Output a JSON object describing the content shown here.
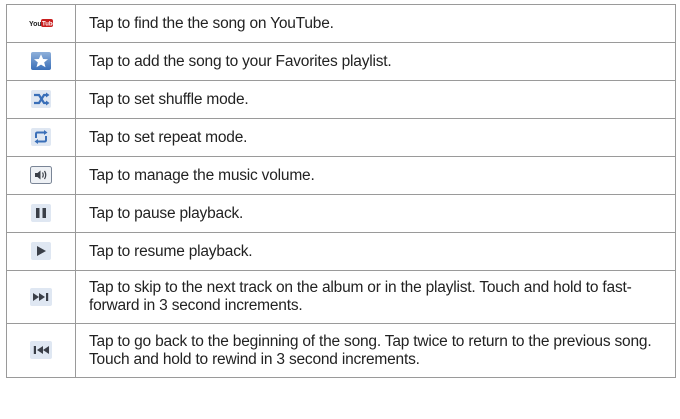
{
  "rows": [
    {
      "icon": "youtube-icon",
      "label": "Tap to find the the song on YouTube."
    },
    {
      "icon": "star-icon",
      "label": "Tap to add the song to your Favorites playlist."
    },
    {
      "icon": "shuffle-icon",
      "label": "Tap to set shuffle mode."
    },
    {
      "icon": "repeat-icon",
      "label": "Tap to set repeat mode."
    },
    {
      "icon": "volume-icon",
      "label": "Tap to manage the music volume."
    },
    {
      "icon": "pause-icon",
      "label": "Tap to pause playback."
    },
    {
      "icon": "play-icon",
      "label": "Tap to resume playback."
    },
    {
      "icon": "next-track-icon",
      "label": "Tap to skip to the next track on the album or in the playlist. Touch and hold to fast-forward in 3 second increments."
    },
    {
      "icon": "previous-track-icon",
      "label": "Tap to go back to the beginning of the song. Tap twice to return to the previous song. Touch and hold to rewind in 3 second increments."
    }
  ],
  "icon_text": {
    "youtube": "You Tube"
  },
  "colors": {
    "icon_blue": "#3a6fb8",
    "icon_light": "#dfe7f2",
    "icon_dark": "#3a3f48",
    "border": "#9a9a9a",
    "text": "#222222"
  }
}
